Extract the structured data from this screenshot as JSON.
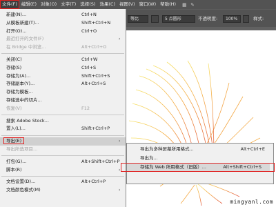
{
  "menubar": {
    "items": [
      "文件(F)",
      "编辑(E)",
      "对象(O)",
      "文字(T)",
      "选择(S)",
      "效果(C)",
      "视图(V)",
      "窗口(W)",
      "帮助(H)"
    ],
    "icons": [
      "grid-icon",
      "brush-icon"
    ]
  },
  "controlbar": {
    "stroke_profile": "等比",
    "brush_value": "5 点圆形",
    "opacity_label": "不透明度:",
    "opacity_value": "100%",
    "style_label": "样式:"
  },
  "file_menu": {
    "rows": [
      {
        "label": "新建(N)...",
        "shortcut": "Ctrl+N"
      },
      {
        "label": "从模板新建(T)...",
        "shortcut": "Shift+Ctrl+N"
      },
      {
        "label": "打开(O)...",
        "shortcut": "Ctrl+O"
      },
      {
        "label": "最近打开的文件(F)",
        "shortcut": ""
      },
      {
        "label": "在 Bridge 中浏览...",
        "shortcut": "Alt+Ctrl+O"
      },
      {
        "label": "关闭(C)",
        "shortcut": "Ctrl+W"
      },
      {
        "label": "存储(S)",
        "shortcut": "Ctrl+S"
      },
      {
        "label": "存储为(A)...",
        "shortcut": "Shift+Ctrl+S"
      },
      {
        "label": "存储副本(Y)...",
        "shortcut": "Alt+Ctrl+S"
      },
      {
        "label": "存储为模板...",
        "shortcut": ""
      },
      {
        "label": "存储选中的切片...",
        "shortcut": ""
      },
      {
        "label": "恢复(V)",
        "shortcut": "F12"
      },
      {
        "label": "搜索 Adobe Stock...",
        "shortcut": ""
      },
      {
        "label": "置入(L)...",
        "shortcut": "Shift+Ctrl+P"
      },
      {
        "label": "导出(E)",
        "shortcut": ""
      },
      {
        "label": "导出所选项目...",
        "shortcut": ""
      },
      {
        "label": "打包(G)...",
        "shortcut": "Alt+Shift+Ctrl+P"
      },
      {
        "label": "脚本(R)",
        "shortcut": ""
      },
      {
        "label": "文档设置(D)...",
        "shortcut": "Alt+Ctrl+P"
      },
      {
        "label": "文档颜色模式(M)",
        "shortcut": ""
      }
    ]
  },
  "export_submenu": {
    "rows": [
      {
        "label": "导出为多种屏幕所用格式...",
        "shortcut": "Alt+Ctrl+E"
      },
      {
        "label": "导出为...",
        "shortcut": ""
      },
      {
        "label": "存储为 Web 所用格式（旧版）...",
        "shortcut": "Alt+Shift+Ctrl+S"
      }
    ]
  },
  "watermark": "mingyanl.com",
  "colors": {
    "highlight_box": "#e02020",
    "menu_bg": "#f0f0f0",
    "ui_dark": "#535353"
  }
}
